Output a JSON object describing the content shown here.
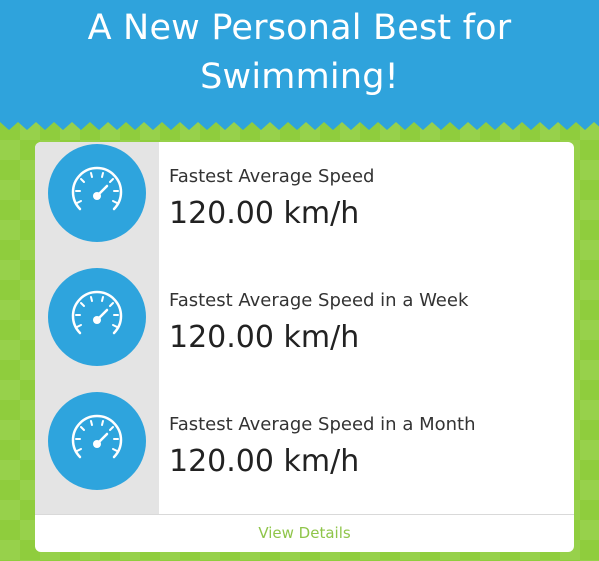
{
  "header": {
    "title_line1": "A New Personal Best for",
    "title_line2": "Swimming!"
  },
  "records": [
    {
      "label": "Fastest Average Speed",
      "value": "120.00 km/h",
      "icon": "speedometer-icon"
    },
    {
      "label": "Fastest Average Speed in a Week",
      "value": "120.00 km/h",
      "icon": "speedometer-icon"
    },
    {
      "label": "Fastest Average Speed in a Month",
      "value": "120.00 km/h",
      "icon": "speedometer-icon"
    }
  ],
  "footer": {
    "link_label": "View Details"
  },
  "colors": {
    "header_blue": "#2fa3dc",
    "background_green": "#8fcd3d",
    "link_green": "#8fc54a",
    "icon_blue": "#2ea4dd"
  }
}
